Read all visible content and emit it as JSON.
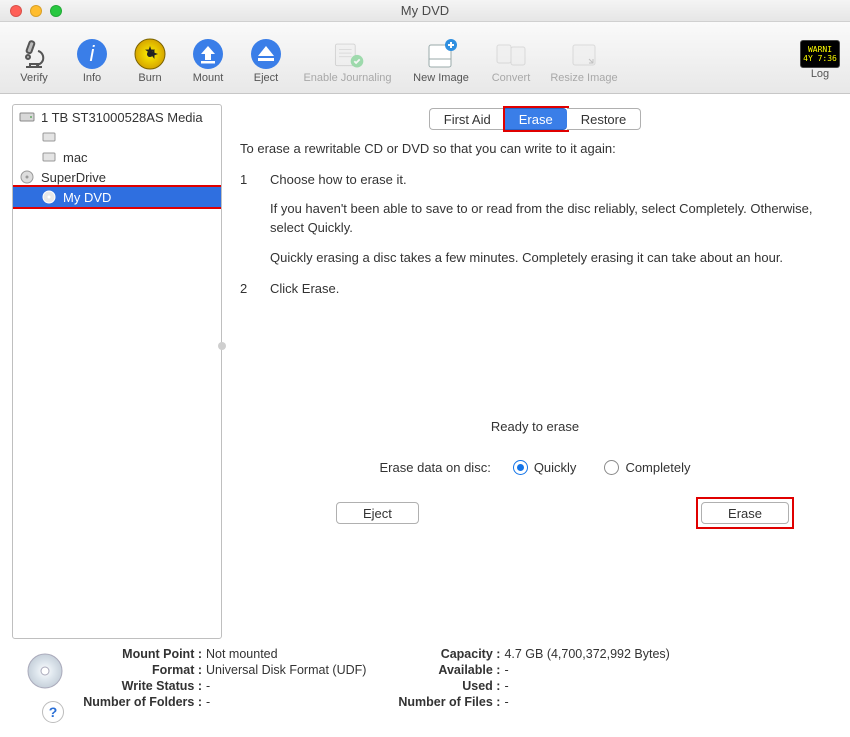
{
  "window": {
    "title": "My DVD"
  },
  "toolbar": {
    "verify": "Verify",
    "info": "Info",
    "burn": "Burn",
    "mount": "Mount",
    "eject": "Eject",
    "enable_journaling": "Enable Journaling",
    "new_image": "New Image",
    "convert": "Convert",
    "resize_image": "Resize Image",
    "log": "Log",
    "log_text1": "WARNI",
    "log_text2": "4Y 7:36"
  },
  "sidebar": {
    "items": [
      {
        "label": "1 TB ST31000528AS Media",
        "icon": "hdd"
      },
      {
        "label": "",
        "icon": "hdd-child"
      },
      {
        "label": "mac",
        "icon": "hdd-child"
      },
      {
        "label": "SuperDrive",
        "icon": "optical-drive"
      },
      {
        "label": "My DVD",
        "icon": "disc"
      }
    ]
  },
  "tabs": {
    "first_aid": "First Aid",
    "erase": "Erase",
    "restore": "Restore"
  },
  "erase": {
    "intro": "To erase a rewritable CD or DVD so that you can write to it again:",
    "step1_num": "1",
    "step1": "Choose how to erase it.",
    "step1a": "If you haven't been able to save to or read from the disc reliably, select Completely. Otherwise, select Quickly.",
    "step1b": "Quickly erasing a disc takes a few minutes. Completely erasing it can take about an hour.",
    "step2_num": "2",
    "step2": "Click Erase.",
    "ready": "Ready to erase",
    "radio_label": "Erase data on disc:",
    "quickly": "Quickly",
    "completely": "Completely",
    "eject_btn": "Eject",
    "erase_btn": "Erase"
  },
  "info": {
    "mount_point_k": "Mount Point :",
    "mount_point_v": "Not mounted",
    "format_k": "Format :",
    "format_v": "Universal Disk Format (UDF)",
    "write_status_k": "Write Status :",
    "write_status_v": "-",
    "num_folders_k": "Number of Folders :",
    "num_folders_v": "-",
    "capacity_k": "Capacity :",
    "capacity_v": "4.7 GB (4,700,372,992 Bytes)",
    "available_k": "Available :",
    "available_v": "-",
    "used_k": "Used :",
    "used_v": "-",
    "num_files_k": "Number of Files :",
    "num_files_v": "-"
  },
  "help": "?"
}
